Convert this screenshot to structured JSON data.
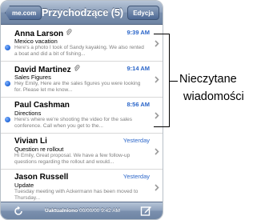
{
  "navbar": {
    "back_label": "me.com",
    "title": "Przychodzące (5)",
    "edit_label": "Edycja"
  },
  "messages": [
    {
      "sender": "Anna Larson",
      "has_attachment": true,
      "time": "9:39 AM",
      "time_bold": true,
      "unread": true,
      "subject": "Mexico vacation",
      "preview": "Here's a photo I took of Sandy kayaking. We also rented a boat and did a bit of fishing..."
    },
    {
      "sender": "David Martinez",
      "has_attachment": true,
      "time": "9:14 AM",
      "time_bold": true,
      "unread": true,
      "subject": "Sales Figures",
      "preview": "Hey Emily, Here are the sales figures you were looking for. Please let me know..."
    },
    {
      "sender": "Paul Cashman",
      "has_attachment": false,
      "time": "8:56 AM",
      "time_bold": true,
      "unread": true,
      "subject": "Directions",
      "preview": "Here's where we're shooting the video for the sales conference. Call when you get to the..."
    },
    {
      "sender": "Vivian Li",
      "has_attachment": false,
      "time": "Yesterday",
      "time_bold": false,
      "unread": false,
      "subject": "Question re rollout",
      "preview": "Hi Emily, Great proposal. We have a few follow-up questions regarding the rollout and would..."
    },
    {
      "sender": "Jason Russell",
      "has_attachment": false,
      "time": "Yesterday",
      "time_bold": false,
      "unread": false,
      "subject": "Update",
      "preview": "Tuesday meeting with Ackermann has been moved to Thursday..."
    }
  ],
  "toolbar": {
    "updated_label": "Uaktualniono",
    "updated_time": "00/00/00 9:42 AM"
  },
  "callout": {
    "line1": "Nieczytane",
    "line2": "wiadomości"
  },
  "colors": {
    "unread_dot": "#1f63d6",
    "time_blue": "#2b66c9",
    "navbar": "#7b90ae"
  },
  "icons": {
    "attachment": "paperclip-icon",
    "chevron": "chevron-right-icon",
    "refresh": "refresh-icon",
    "compose": "compose-icon",
    "unread": "unread-dot-icon"
  }
}
